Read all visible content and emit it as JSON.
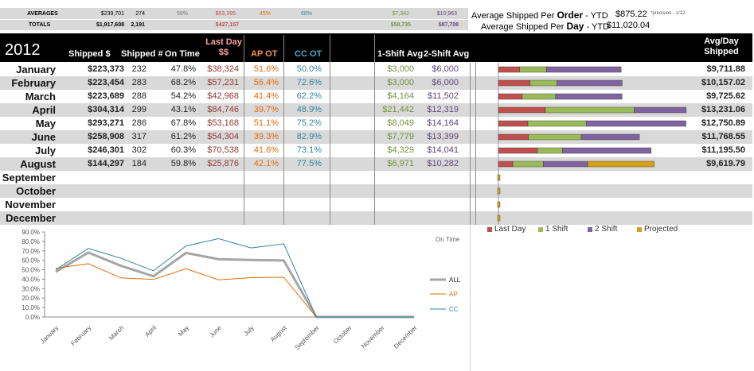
{
  "summary": {
    "averages_label": "AVERAGES",
    "totals_label": "TOTALS",
    "averages": {
      "shipped": "$239,701",
      "count": "274",
      "on_time": "58%",
      "last_day": "$53,395",
      "ap_ot": "45%",
      "cc_ot": "68%",
      "shift1": "$7,342",
      "shift2": "$10,963"
    },
    "totals": {
      "shipped": "$1,917,608",
      "count": "2,191",
      "last_day": "$427,157",
      "shift1": "$58,735",
      "shift2": "$87,708"
    }
  },
  "ytd": {
    "order_prefix": "Average Shipped Per",
    "order_word": "Order",
    "order_suffix": " - YTD",
    "order_value": "$875.22",
    "precision_note": "*precision - 1/12",
    "day_prefix": "Average Shipped Per",
    "day_word": "Day",
    "day_suffix": " - YTD",
    "day_value": "$11,020.04"
  },
  "header": {
    "year": "2012",
    "shipped": "Shipped $",
    "shipped_count": "Shipped #",
    "on_time": "On Time",
    "last_day": "Last Day $$",
    "ap_ot": "AP OT",
    "cc_ot": "CC OT",
    "shift1": "1-Shift Avg",
    "shift2": "2-Shift Avg",
    "avg_day": "Avg/Day Shipped"
  },
  "colors": {
    "ap": "#e36c0a",
    "cc": "#31859c",
    "last_day": "#c0504d",
    "shift1": "#9bbb59",
    "shift2": "#8064a2",
    "projected": "#d4a017",
    "shift1_text": "#76923c",
    "shift2_text": "#5f497a",
    "last_text": "#953735"
  },
  "months": [
    {
      "name": "January",
      "shipped": "$223,373",
      "count": "232",
      "on_time": "47.8%",
      "last_day": "$38,324",
      "ap": "51.6%",
      "cc": "50.0%",
      "s1": "$3,000",
      "s2": "$6,000",
      "avg": "$9,711.88"
    },
    {
      "name": "February",
      "shipped": "$223,454",
      "count": "283",
      "on_time": "68.2%",
      "last_day": "$57,231",
      "ap": "56.4%",
      "cc": "72.6%",
      "s1": "$3,000",
      "s2": "$6,000",
      "avg": "$10,157.02"
    },
    {
      "name": "March",
      "shipped": "$223,689",
      "count": "288",
      "on_time": "54.2%",
      "last_day": "$42,968",
      "ap": "41.4%",
      "cc": "62.2%",
      "s1": "$4,164",
      "s2": "$11,502",
      "avg": "$9,725.62"
    },
    {
      "name": "April",
      "shipped": "$304,314",
      "count": "299",
      "on_time": "43.1%",
      "last_day": "$84,746",
      "ap": "39.7%",
      "cc": "48.9%",
      "s1": "$21,442",
      "s2": "$12,319",
      "avg": "$13,231.06"
    },
    {
      "name": "May",
      "shipped": "$293,271",
      "count": "286",
      "on_time": "67.8%",
      "last_day": "$53,168",
      "ap": "51.1%",
      "cc": "75.2%",
      "s1": "$8,049",
      "s2": "$14,164",
      "avg": "$12,750.89"
    },
    {
      "name": "June",
      "shipped": "$258,908",
      "count": "317",
      "on_time": "61.2%",
      "last_day": "$54,304",
      "ap": "39.3%",
      "cc": "82.9%",
      "s1": "$7,779",
      "s2": "$13,399",
      "avg": "$11,768.55"
    },
    {
      "name": "July",
      "shipped": "$246,301",
      "count": "302",
      "on_time": "60.3%",
      "last_day": "$70,538",
      "ap": "41.6%",
      "cc": "73.1%",
      "s1": "$4,329",
      "s2": "$14,041",
      "avg": "$11,195.50"
    },
    {
      "name": "August",
      "shipped": "$144,297",
      "count": "184",
      "on_time": "59.8%",
      "last_day": "$25,876",
      "ap": "42.1%",
      "cc": "77.5%",
      "s1": "$6,971",
      "s2": "$10,282",
      "avg": "$9,619.79"
    },
    {
      "name": "September",
      "shipped": "",
      "count": "",
      "on_time": "",
      "last_day": "",
      "ap": "",
      "cc": "",
      "s1": "",
      "s2": "",
      "avg": ""
    },
    {
      "name": "October",
      "shipped": "",
      "count": "",
      "on_time": "",
      "last_day": "",
      "ap": "",
      "cc": "",
      "s1": "",
      "s2": "",
      "avg": ""
    },
    {
      "name": "November",
      "shipped": "",
      "count": "",
      "on_time": "",
      "last_day": "",
      "ap": "",
      "cc": "",
      "s1": "",
      "s2": "",
      "avg": ""
    },
    {
      "name": "December",
      "shipped": "",
      "count": "",
      "on_time": "",
      "last_day": "",
      "ap": "",
      "cc": "",
      "s1": "",
      "s2": "",
      "avg": ""
    }
  ],
  "bar_legend": [
    "Last Day",
    "1 Shift",
    "2 Shift",
    "Projected"
  ],
  "chart_data": [
    {
      "type": "bar",
      "orientation": "horizontal",
      "stacked": true,
      "categories": [
        "January",
        "February",
        "March",
        "April",
        "May",
        "June",
        "July",
        "August",
        "September",
        "October",
        "November",
        "December"
      ],
      "series": [
        {
          "name": "Last Day",
          "values": [
            38324,
            57231,
            42968,
            84746,
            53168,
            54304,
            70538,
            25876,
            0,
            0,
            0,
            0
          ]
        },
        {
          "name": "1 Shift",
          "values": [
            48000,
            48000,
            60000,
            160000,
            105000,
            95000,
            45000,
            55000,
            0,
            0,
            0,
            0
          ]
        },
        {
          "name": "2 Shift",
          "values": [
            135000,
            118000,
            120000,
            94000,
            180000,
            105000,
            160000,
            80000,
            0,
            0,
            0,
            0
          ]
        },
        {
          "name": "Projected",
          "values": [
            0,
            0,
            0,
            0,
            0,
            0,
            0,
            120000,
            0,
            0,
            0,
            0
          ]
        }
      ],
      "legend": "bottom"
    },
    {
      "type": "line",
      "categories": [
        "January",
        "February",
        "March",
        "April",
        "May",
        "June",
        "July",
        "August",
        "September",
        "October",
        "November",
        "December"
      ],
      "series": [
        {
          "name": "ALL",
          "values": [
            47.8,
            68.2,
            54.2,
            43.1,
            67.8,
            61.2,
            60.3,
            59.8,
            0,
            0,
            0,
            0
          ]
        },
        {
          "name": "AP",
          "values": [
            51.6,
            56.4,
            41.4,
            39.7,
            51.1,
            39.3,
            41.6,
            42.1,
            0,
            0,
            0,
            0
          ]
        },
        {
          "name": "CC",
          "values": [
            50.0,
            72.6,
            62.2,
            48.9,
            75.2,
            82.9,
            73.1,
            77.5,
            0,
            0,
            0,
            0
          ]
        }
      ],
      "series_colors": [
        "#a6a6a6",
        "#e36c0a",
        "#31859c"
      ],
      "ylim": [
        0,
        90
      ],
      "yticks": [
        "90.0%",
        "80.0%",
        "70.0%",
        "60.0%",
        "50.0%",
        "40.0%",
        "30.0%",
        "20.0%",
        "10.0%",
        "0.0%"
      ],
      "title": "On Time",
      "legend": "right",
      "grid": false
    }
  ]
}
